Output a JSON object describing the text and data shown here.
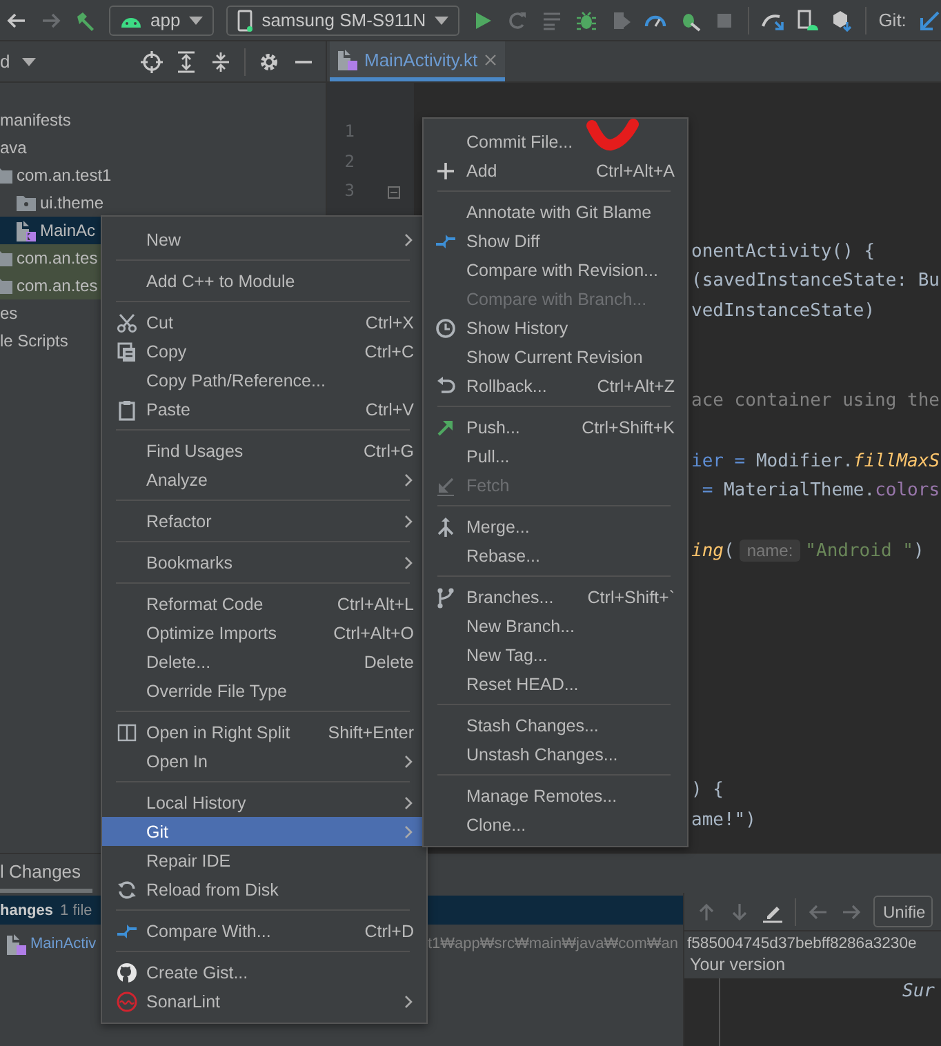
{
  "toolbar": {
    "run_config": "app",
    "device": "samsung SM-S911N",
    "vcs_label": "Git:"
  },
  "project_panel": {
    "title": "d",
    "tree": [
      {
        "label": "manifests",
        "selected": false,
        "highlighted": false
      },
      {
        "label": "ava",
        "selected": false,
        "highlighted": false,
        "children": [
          {
            "label": "com.an.test1",
            "kind": "folder",
            "selected": false,
            "highlighted": false,
            "children": [
              {
                "label": "ui.theme",
                "kind": "folder",
                "selected": false,
                "highlighted": false
              },
              {
                "label": "MainAc",
                "kind": "file",
                "selected": true,
                "highlighted": false
              }
            ]
          },
          {
            "label": "com.an.tes",
            "kind": "folder",
            "selected": false,
            "highlighted": true
          },
          {
            "label": "com.an.tes",
            "kind": "folder",
            "selected": false,
            "highlighted": true
          }
        ]
      },
      {
        "label": "es",
        "selected": false,
        "highlighted": false
      },
      {
        "label": "le Scripts",
        "selected": false,
        "highlighted": false
      }
    ]
  },
  "editor": {
    "tabs": [
      {
        "label": "MainActivity.kt",
        "selected": true
      }
    ],
    "line_numbers": [
      "1",
      "2",
      "3"
    ],
    "code_lines": [
      {
        "segments": [
          {
            "kind": "plain",
            "text": "onentActivity() {"
          }
        ]
      },
      {
        "segments": [
          {
            "kind": "plain",
            "text": "(savedInstanceState: Bu"
          }
        ]
      },
      {
        "segments": [
          {
            "kind": "plain",
            "text": "vedInstanceState)"
          }
        ]
      },
      {
        "segments": [
          {
            "kind": "comment",
            "text": "ace container using the"
          }
        ]
      },
      {
        "segments": [
          {
            "kind": "param",
            "text": "ier = "
          },
          {
            "kind": "plain",
            "text": "Modifier."
          },
          {
            "kind": "call",
            "text": "fillMaxS"
          }
        ]
      },
      {
        "segments": [
          {
            "kind": "param",
            "text": " = "
          },
          {
            "kind": "plain",
            "text": "MaterialTheme."
          },
          {
            "kind": "field",
            "text": "colors"
          }
        ]
      },
      {
        "segments": [
          {
            "kind": "call",
            "text": "ing"
          },
          {
            "kind": "plain",
            "text": "("
          },
          {
            "kind": "hint",
            "text": "name:"
          },
          {
            "kind": "string",
            "text": "\"Android \""
          },
          {
            "kind": "plain",
            "text": ")"
          }
        ]
      },
      {
        "segments": [
          {
            "kind": "plain",
            "text": ") {"
          }
        ]
      },
      {
        "segments": [
          {
            "kind": "plain",
            "text": "ame!\")"
          }
        ]
      }
    ]
  },
  "context_menu": {
    "items": [
      {
        "kind": "item",
        "label": "New",
        "submenu": true,
        "disabled": false,
        "selected": false
      },
      {
        "kind": "separator"
      },
      {
        "kind": "item",
        "label": "Add C++ to Module",
        "submenu": false,
        "disabled": false,
        "selected": false
      },
      {
        "kind": "separator"
      },
      {
        "kind": "item",
        "label": "Cut",
        "shortcut": "Ctrl+X",
        "submenu": false,
        "disabled": false,
        "selected": false
      },
      {
        "kind": "item",
        "label": "Copy",
        "shortcut": "Ctrl+C",
        "submenu": false,
        "disabled": false,
        "selected": false
      },
      {
        "kind": "item",
        "label": "Copy Path/Reference...",
        "submenu": false,
        "disabled": false,
        "selected": false
      },
      {
        "kind": "item",
        "label": "Paste",
        "shortcut": "Ctrl+V",
        "submenu": false,
        "disabled": false,
        "selected": false
      },
      {
        "kind": "separator"
      },
      {
        "kind": "item",
        "label": "Find Usages",
        "shortcut": "Ctrl+G",
        "submenu": false,
        "disabled": false,
        "selected": false
      },
      {
        "kind": "item",
        "label": "Analyze",
        "submenu": true,
        "disabled": false,
        "selected": false
      },
      {
        "kind": "separator"
      },
      {
        "kind": "item",
        "label": "Refactor",
        "submenu": true,
        "disabled": false,
        "selected": false
      },
      {
        "kind": "separator"
      },
      {
        "kind": "item",
        "label": "Bookmarks",
        "submenu": true,
        "disabled": false,
        "selected": false
      },
      {
        "kind": "separator"
      },
      {
        "kind": "item",
        "label": "Reformat Code",
        "shortcut": "Ctrl+Alt+L",
        "submenu": false,
        "disabled": false,
        "selected": false
      },
      {
        "kind": "item",
        "label": "Optimize Imports",
        "shortcut": "Ctrl+Alt+O",
        "submenu": false,
        "disabled": false,
        "selected": false
      },
      {
        "kind": "item",
        "label": "Delete...",
        "shortcut": "Delete",
        "submenu": false,
        "disabled": false,
        "selected": false
      },
      {
        "kind": "item",
        "label": "Override File Type",
        "submenu": false,
        "disabled": false,
        "selected": false
      },
      {
        "kind": "separator"
      },
      {
        "kind": "item",
        "label": "Open in Right Split",
        "shortcut": "Shift+Enter",
        "submenu": false,
        "disabled": false,
        "selected": false
      },
      {
        "kind": "item",
        "label": "Open In",
        "submenu": true,
        "disabled": false,
        "selected": false
      },
      {
        "kind": "separator"
      },
      {
        "kind": "item",
        "label": "Local History",
        "submenu": true,
        "disabled": false,
        "selected": false
      },
      {
        "kind": "item",
        "label": "Git",
        "submenu": true,
        "disabled": false,
        "selected": true
      },
      {
        "kind": "item",
        "label": "Repair IDE",
        "submenu": false,
        "disabled": false,
        "selected": false
      },
      {
        "kind": "item",
        "label": "Reload from Disk",
        "submenu": false,
        "disabled": false,
        "selected": false
      },
      {
        "kind": "separator"
      },
      {
        "kind": "item",
        "label": "Compare With...",
        "shortcut": "Ctrl+D",
        "submenu": false,
        "disabled": false,
        "selected": false
      },
      {
        "kind": "separator"
      },
      {
        "kind": "item",
        "label": "Create Gist...",
        "submenu": false,
        "disabled": false,
        "selected": false
      },
      {
        "kind": "item",
        "label": "SonarLint",
        "submenu": true,
        "disabled": false,
        "selected": false
      }
    ]
  },
  "git_submenu": {
    "items": [
      {
        "kind": "item",
        "label": "Commit File...",
        "disabled": false,
        "selected": false
      },
      {
        "kind": "item",
        "label": "Add",
        "shortcut": "Ctrl+Alt+A",
        "disabled": false,
        "selected": false
      },
      {
        "kind": "separator"
      },
      {
        "kind": "item",
        "label": "Annotate with Git Blame",
        "disabled": false,
        "selected": false
      },
      {
        "kind": "item",
        "label": "Show Diff",
        "disabled": false,
        "selected": false
      },
      {
        "kind": "item",
        "label": "Compare with Revision...",
        "disabled": false,
        "selected": false
      },
      {
        "kind": "item",
        "label": "Compare with Branch...",
        "disabled": true,
        "selected": false
      },
      {
        "kind": "item",
        "label": "Show History",
        "disabled": false,
        "selected": false
      },
      {
        "kind": "item",
        "label": "Show Current Revision",
        "disabled": false,
        "selected": false
      },
      {
        "kind": "item",
        "label": "Rollback...",
        "shortcut": "Ctrl+Alt+Z",
        "disabled": false,
        "selected": false
      },
      {
        "kind": "separator"
      },
      {
        "kind": "item",
        "label": "Push...",
        "shortcut": "Ctrl+Shift+K",
        "disabled": false,
        "selected": false
      },
      {
        "kind": "item",
        "label": "Pull...",
        "disabled": false,
        "selected": false
      },
      {
        "kind": "item",
        "label": "Fetch",
        "disabled": true,
        "selected": false
      },
      {
        "kind": "separator"
      },
      {
        "kind": "item",
        "label": "Merge...",
        "disabled": false,
        "selected": false
      },
      {
        "kind": "item",
        "label": "Rebase...",
        "disabled": false,
        "selected": false
      },
      {
        "kind": "separator"
      },
      {
        "kind": "item",
        "label": "Branches...",
        "shortcut": "Ctrl+Shift+`",
        "disabled": false,
        "selected": false
      },
      {
        "kind": "item",
        "label": "New Branch...",
        "disabled": false,
        "selected": false
      },
      {
        "kind": "item",
        "label": "New Tag...",
        "disabled": false,
        "selected": false
      },
      {
        "kind": "item",
        "label": "Reset HEAD...",
        "disabled": false,
        "selected": false
      },
      {
        "kind": "separator"
      },
      {
        "kind": "item",
        "label": "Stash Changes...",
        "disabled": false,
        "selected": false
      },
      {
        "kind": "item",
        "label": "Unstash Changes...",
        "disabled": false,
        "selected": false
      },
      {
        "kind": "separator"
      },
      {
        "kind": "item",
        "label": "Manage Remotes...",
        "disabled": false,
        "selected": false
      },
      {
        "kind": "item",
        "label": "Clone...",
        "disabled": false,
        "selected": false
      }
    ]
  },
  "changes_panel": {
    "tab": "l Changes",
    "group": {
      "label": "hanges",
      "count": "1 file"
    },
    "file": {
      "name": "MainActiv",
      "path": "t1₩app₩src₩main₩java₩com₩an"
    }
  },
  "diff_viewer": {
    "mode": "Unifie",
    "revision": "f585004745d37bebff8286a3230e",
    "version_label": "Your version",
    "code": "Sur"
  }
}
